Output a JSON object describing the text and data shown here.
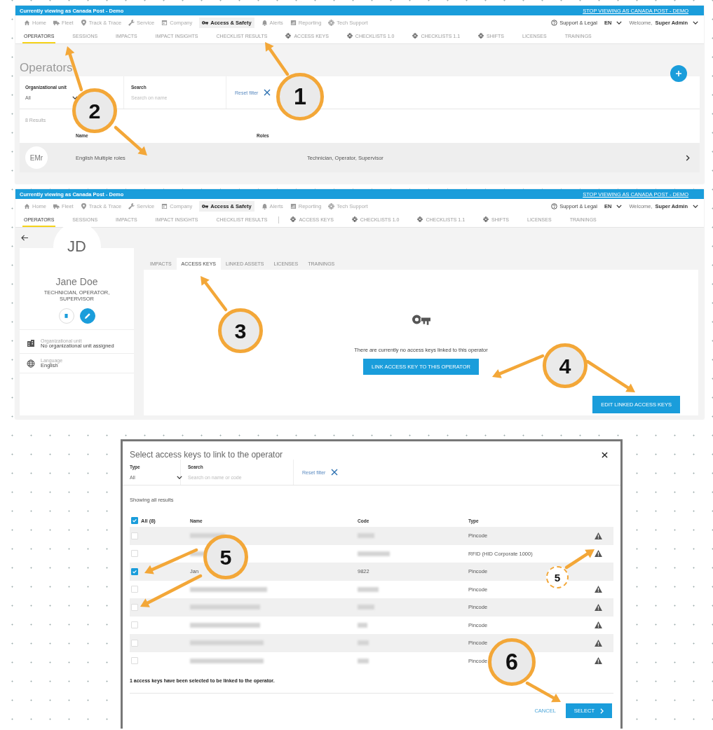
{
  "screens": [
    {
      "kind": "operator_list",
      "header": {
        "banner": "Currently viewing as Canada Post - Demo",
        "stop_link": "STOP VIEWING AS CANADA POST - DEMO",
        "nav": [
          {
            "label": "Home",
            "selected": false
          },
          {
            "label": "Fleet",
            "selected": false
          },
          {
            "label": "Track & Trace",
            "selected": false
          },
          {
            "label": "Service",
            "selected": false
          },
          {
            "label": "Company",
            "selected": false
          },
          {
            "label": "Access & Safety",
            "selected": true
          },
          {
            "label": "Alerts",
            "selected": false
          },
          {
            "label": "Reporting",
            "selected": false
          },
          {
            "label": "Tech Support",
            "selected": false
          }
        ],
        "support": "Support & Legal",
        "language": "EN",
        "welcome": "Welcome,",
        "user": "Super Admin",
        "tabs": [
          {
            "label": "OPERATORS",
            "selected": true,
            "kind": "plain"
          },
          {
            "label": "SESSIONS",
            "selected": false,
            "kind": "plain"
          },
          {
            "label": "IMPACTS",
            "selected": false,
            "kind": "plain"
          },
          {
            "label": "IMPACT INSIGHTS",
            "selected": false,
            "kind": "plain"
          },
          {
            "label": "CHECKLIST RESULTS",
            "selected": false,
            "kind": "plain"
          },
          {
            "label": "ACCESS KEYS",
            "selected": false,
            "kind": "config"
          },
          {
            "label": "CHECKLISTS 1.0",
            "selected": false,
            "kind": "config"
          },
          {
            "label": "CHECKLISTS 1.1",
            "selected": false,
            "kind": "config"
          },
          {
            "label": "SHIFTS",
            "selected": false,
            "kind": "config"
          },
          {
            "label": "LICENSES",
            "selected": false,
            "kind": "plain"
          },
          {
            "label": "TRAININGS",
            "selected": false,
            "kind": "plain"
          }
        ]
      },
      "title": "Operators",
      "filters": {
        "unit_label": "Organizational unit",
        "unit_value": "All",
        "search_label": "Search",
        "search_placeholder": "Search on name",
        "reset": "Reset filter"
      },
      "results": "8 Results",
      "columns": [
        "Name",
        "Roles"
      ],
      "rows": [
        {
          "initials": "EMr",
          "name": "English Multiple roles",
          "roles": "Technician, Operator, Supervisor"
        }
      ]
    },
    {
      "kind": "operator_detail",
      "header": {
        "banner": "Currently viewing as Canada Post - Demo",
        "stop_link": "STOP VIEWING AS CANADA POST - DEMO",
        "nav": [
          {
            "label": "Home",
            "selected": false
          },
          {
            "label": "Fleet",
            "selected": false
          },
          {
            "label": "Track & Trace",
            "selected": false
          },
          {
            "label": "Service",
            "selected": false
          },
          {
            "label": "Company",
            "selected": false
          },
          {
            "label": "Access & Safety",
            "selected": true
          },
          {
            "label": "Alerts",
            "selected": false
          },
          {
            "label": "Reporting",
            "selected": false
          },
          {
            "label": "Tech Support",
            "selected": false
          }
        ],
        "support": "Support & Legal",
        "language": "EN",
        "welcome": "Welcome,",
        "user": "Super Admin",
        "separator": true,
        "tabs": [
          {
            "label": "OPERATORS",
            "selected": true,
            "kind": "plain"
          },
          {
            "label": "SESSIONS",
            "selected": false,
            "kind": "plain"
          },
          {
            "label": "IMPACTS",
            "selected": false,
            "kind": "plain"
          },
          {
            "label": "IMPACT INSIGHTS",
            "selected": false,
            "kind": "plain"
          },
          {
            "label": "CHECKLIST RESULTS",
            "selected": false,
            "kind": "plain"
          },
          {
            "label": "ACCESS KEYS",
            "selected": false,
            "kind": "config"
          },
          {
            "label": "CHECKLISTS 1.0",
            "selected": false,
            "kind": "config"
          },
          {
            "label": "CHECKLISTS 1.1",
            "selected": false,
            "kind": "config"
          },
          {
            "label": "SHIFTS",
            "selected": false,
            "kind": "config"
          },
          {
            "label": "LICENSES",
            "selected": false,
            "kind": "plain"
          },
          {
            "label": "TRAININGS",
            "selected": false,
            "kind": "plain"
          }
        ]
      },
      "profile": {
        "initials": "JD",
        "name": "Jane Doe",
        "roles": "TECHNICIAN, OPERATOR, SUPERVISOR",
        "details": [
          {
            "label": "Organizational unit",
            "value": "No organizational unit assigned"
          },
          {
            "label": "Language",
            "value": "English"
          }
        ]
      },
      "tabs": [
        {
          "label": "IMPACTS",
          "selected": false
        },
        {
          "label": "ACCESS KEYS",
          "selected": true
        },
        {
          "label": "LINKED ASSETS",
          "selected": false
        },
        {
          "label": "LICENSES",
          "selected": false
        },
        {
          "label": "TRAININGS",
          "selected": false
        }
      ],
      "empty_message": "There are currently no access keys linked to this operator",
      "link_button": "LINK ACCESS KEY TO THIS OPERATOR",
      "edit_button": "EDIT LINKED ACCESS KEYS"
    }
  ],
  "dialog": {
    "title": "Select access keys to link to the operator",
    "type_label": "Type",
    "type_value": "All",
    "search_label": "Search",
    "search_placeholder": "Search on name or code",
    "reset": "Reset filter",
    "summary": "Showing all results",
    "select_all": {
      "label": "All (8)",
      "checked": true
    },
    "columns": [
      "Name",
      "Code",
      "Type"
    ],
    "rows": [
      {
        "checked": false,
        "redacted": true,
        "type": "Pincode",
        "warning": true
      },
      {
        "checked": false,
        "redacted": true,
        "type": "RFID (HID Corporate 1000)",
        "warning": true
      },
      {
        "checked": true,
        "redacted": false,
        "name": "Jan",
        "code": "9822",
        "type": "Pincode",
        "warning": false
      },
      {
        "checked": false,
        "redacted": true,
        "type": "Pincode",
        "warning": true
      },
      {
        "checked": false,
        "redacted": true,
        "type": "Pincode",
        "warning": true
      },
      {
        "checked": false,
        "redacted": true,
        "type": "Pincode",
        "warning": true
      },
      {
        "checked": false,
        "redacted": true,
        "type": "Pincode",
        "warning": true
      },
      {
        "checked": false,
        "redacted": true,
        "type": "Pincode",
        "warning": true
      }
    ],
    "footer": "1 access keys have been selected to be linked to the operator.",
    "cancel": "CANCEL",
    "select": "SELECT"
  },
  "callouts": [
    {
      "label": "1",
      "kind": "solid"
    },
    {
      "label": "2",
      "kind": "solid"
    },
    {
      "label": "3",
      "kind": "solid"
    },
    {
      "label": "4",
      "kind": "solid"
    },
    {
      "label": "5",
      "kind": "solid"
    },
    {
      "label": "5",
      "kind": "dashed"
    },
    {
      "label": "6",
      "kind": "solid"
    }
  ]
}
